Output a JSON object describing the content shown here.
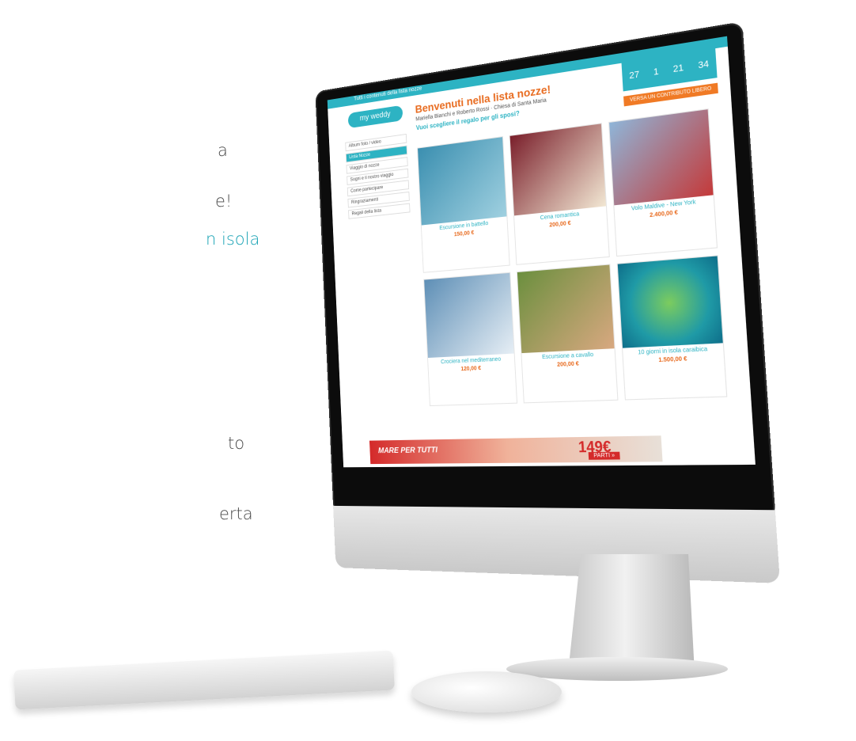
{
  "left_lines": [
    {
      "text": "a",
      "color": "dark"
    },
    {
      "text": "e!",
      "color": "dark"
    },
    {
      "text": "n isola,",
      "color": "teal"
    },
    {
      "text": "to",
      "color": "dark"
    },
    {
      "text": "erta",
      "color": "dark"
    }
  ],
  "screen": {
    "topbar_text": "Tutti i contenuti della lista nozze",
    "logo": "my weddy",
    "menu": [
      "Album foto / video",
      "Lista Nozze",
      "Viaggio di nozze",
      "Sogni e il nostro viaggio",
      "Come partecipare",
      "Ringraziamenti",
      "Regali della lista"
    ],
    "heading": "Benvenuti nella lista nozze!",
    "subtitle": "Mariella Bianchi e Roberto Rossi · Chiesa di Santa Maria",
    "question": "Vuoi scegliere il regalo per gli sposi?",
    "countdown": [
      "27",
      "1",
      "21",
      "34"
    ],
    "gift_button": "VERSA UN CONTRIBUTO LIBERO",
    "cards": [
      {
        "title": "Escursione in battello",
        "price": "150,00 €",
        "img": "#3b8fb0"
      },
      {
        "title": "Cena romantica",
        "price": "200,00 €",
        "img": "#7a1f2b"
      },
      {
        "title": "Volo Maldive - New York",
        "price": "2.400,00 €",
        "img": "#8fb5d8"
      },
      {
        "title": "Crociera nel mediterraneo",
        "price": "120,00 €",
        "img": "#5e8fb6"
      },
      {
        "title": "Escursione a cavallo",
        "price": "200,00 €",
        "img": "#6b8f3e"
      },
      {
        "title": "10 giorni in isola caraibica",
        "price": "1.500,00 €",
        "img": "#1f9aa6"
      }
    ],
    "banner_left": "MARE PER TUTTI",
    "banner_price": "149€",
    "banner_button": "PARTI »"
  }
}
